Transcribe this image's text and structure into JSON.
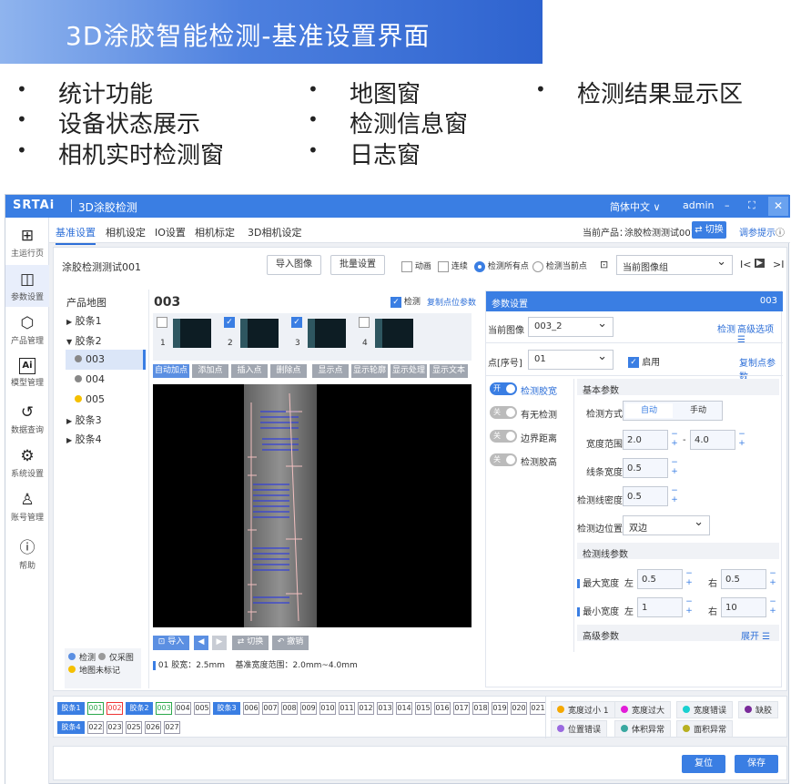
{
  "banner": {
    "title": "3D涂胶智能检测-基准设置界面"
  },
  "bullets": [
    "统计功能",
    "设备状态展示",
    "相机实时检测窗",
    "地图窗",
    "检测信息窗",
    "日志窗",
    "检测结果显示区"
  ],
  "app": {
    "logo": "SRTAi",
    "title": "3D涂胶检测",
    "lang": "简体中文 ∨",
    "user": "admin",
    "win_controls": [
      "–",
      "⛶",
      "✕"
    ]
  },
  "sidebar": [
    {
      "icon": "grid",
      "label": "主运行页"
    },
    {
      "icon": "param",
      "label": "参数设置"
    },
    {
      "icon": "cube",
      "label": "产品管理"
    },
    {
      "icon": "ai",
      "label": "模型管理"
    },
    {
      "icon": "history",
      "label": "数据查询"
    },
    {
      "icon": "gear",
      "label": "系统设置"
    },
    {
      "icon": "user",
      "label": "账号管理"
    },
    {
      "icon": "help",
      "label": "帮助"
    }
  ],
  "tabs": [
    "基准设置",
    "相机设定",
    "IO设置",
    "相机标定",
    "3D相机设定"
  ],
  "current_product": {
    "label": "当前产品：",
    "value": "涂胶检测测试001",
    "switch": "⇄ 切换",
    "help": "调参提示"
  },
  "toolbar": {
    "product": "涂胶检测测试001",
    "import_image": "导入图像",
    "batch": "批量设置",
    "animation": "动画",
    "continuous": "连续",
    "detect_all": "检测所有点",
    "detect_current": "检测当前点",
    "current_group": "当前图像组",
    "nav": [
      "I<",
      "▶",
      ">I"
    ]
  },
  "map": {
    "title": "产品地图",
    "items": [
      {
        "label": "胶条1",
        "arrow": "▶"
      },
      {
        "label": "胶条2",
        "arrow": "▼"
      },
      {
        "label": "003",
        "color": "#888888"
      },
      {
        "label": "004",
        "color": "#888888"
      },
      {
        "label": "005",
        "color": "#f5c000"
      },
      {
        "label": "胶条3",
        "arrow": "▶"
      },
      {
        "label": "胶条4",
        "arrow": "▶"
      }
    ],
    "legend": [
      {
        "label": "检测",
        "color": "#5b8fe2"
      },
      {
        "label": "仅采图",
        "color": "#9a9a9a"
      },
      {
        "label": "地图未标记",
        "color": "#f5c000"
      }
    ]
  },
  "point": {
    "name": "003",
    "detect": "检测",
    "copy": "复制点位参数",
    "thumbs": [
      {
        "num": "1",
        "checked": false
      },
      {
        "num": "2",
        "checked": true
      },
      {
        "num": "3",
        "checked": true
      },
      {
        "num": "4",
        "checked": false
      }
    ]
  },
  "image_tools": [
    "自动加点",
    "添加点",
    "插入点",
    "删除点",
    "显示点",
    "显示轮廓",
    "显示处理",
    "显示文本"
  ],
  "image_actions": {
    "import": "⊡ 导入",
    "left": "◀",
    "right": "▶",
    "switch": "⇄ 切换",
    "undo": "↶ 撤销"
  },
  "info": {
    "idx": "01",
    "glue": "胶宽：2.5mm",
    "range": "基准宽度范围：2.0mm~4.0mm"
  },
  "params": {
    "header": "参数设置",
    "code": "003",
    "cur_image_label": "当前图像",
    "cur_image": "003_2",
    "detect": "检测",
    "advanced": "高级选项 ☰",
    "point_label": "点[序号]",
    "point": "01",
    "enable": "启用",
    "copy": "复制点参数",
    "toggles": [
      {
        "on": true,
        "state": "开",
        "label": "检测胶宽"
      },
      {
        "on": false,
        "state": "关",
        "label": "有无检测"
      },
      {
        "on": false,
        "state": "关",
        "label": "边界距离"
      },
      {
        "on": false,
        "state": "关",
        "label": "检测胶高"
      }
    ],
    "basic_title": "基本参数",
    "mode_label": "检测方式",
    "mode_auto": "自动",
    "mode_manual": "手动",
    "width_label": "宽度范围",
    "width_min": "2.0",
    "width_max": "4.0",
    "dash": "-",
    "spacing_label": "线条宽度",
    "spacing": "0.5",
    "density_label": "检测线密度",
    "density": "0.5",
    "edge_label": "检测边位置",
    "edge": "双边",
    "line_title": "检测线参数",
    "max_label": "最大宽度",
    "min_label": "最小宽度",
    "left": "左",
    "right": "右",
    "max_l": "0.5",
    "max_r": "0.5",
    "min_l": "1",
    "min_r": "10",
    "adv_title": "高级参数",
    "expand": "展开 ☰"
  },
  "bottom": {
    "row1": [
      {
        "t": "胶条1",
        "c": "blue"
      },
      {
        "t": "001",
        "c": "green"
      },
      {
        "t": "002",
        "c": "red"
      },
      {
        "t": "胶条2",
        "c": "blue"
      },
      {
        "t": "003",
        "c": "green"
      },
      {
        "t": "004",
        "c": ""
      },
      {
        "t": "005",
        "c": ""
      },
      {
        "t": "胶条3",
        "c": "blue"
      },
      {
        "t": "006",
        "c": ""
      },
      {
        "t": "007",
        "c": ""
      },
      {
        "t": "008",
        "c": ""
      },
      {
        "t": "009",
        "c": ""
      },
      {
        "t": "010",
        "c": ""
      },
      {
        "t": "011",
        "c": ""
      },
      {
        "t": "012",
        "c": ""
      },
      {
        "t": "013",
        "c": ""
      },
      {
        "t": "014",
        "c": ""
      },
      {
        "t": "015",
        "c": ""
      },
      {
        "t": "016",
        "c": ""
      },
      {
        "t": "017",
        "c": ""
      },
      {
        "t": "018",
        "c": ""
      },
      {
        "t": "019",
        "c": ""
      },
      {
        "t": "020",
        "c": ""
      },
      {
        "t": "021",
        "c": ""
      }
    ],
    "row2": [
      {
        "t": "胶条4",
        "c": "blue"
      },
      {
        "t": "022",
        "c": ""
      },
      {
        "t": "023",
        "c": ""
      },
      {
        "t": "025",
        "c": ""
      },
      {
        "t": "026",
        "c": ""
      },
      {
        "t": "027",
        "c": ""
      }
    ],
    "results": [
      {
        "t": "宽度过小",
        "n": "1",
        "color": "#f5a800"
      },
      {
        "t": "宽度过大",
        "color": "#e21dd8"
      },
      {
        "t": "宽度错误",
        "color": "#19d0d0"
      },
      {
        "t": "缺胶",
        "color": "#7a2a9a"
      },
      {
        "t": "位置错误",
        "color": "#9a6ae0"
      },
      {
        "t": "体积异常",
        "color": "#3aa8a0"
      },
      {
        "t": "面积异常",
        "color": "#b8b020"
      }
    ]
  },
  "footer": {
    "reset": "复位",
    "save": "保存"
  }
}
